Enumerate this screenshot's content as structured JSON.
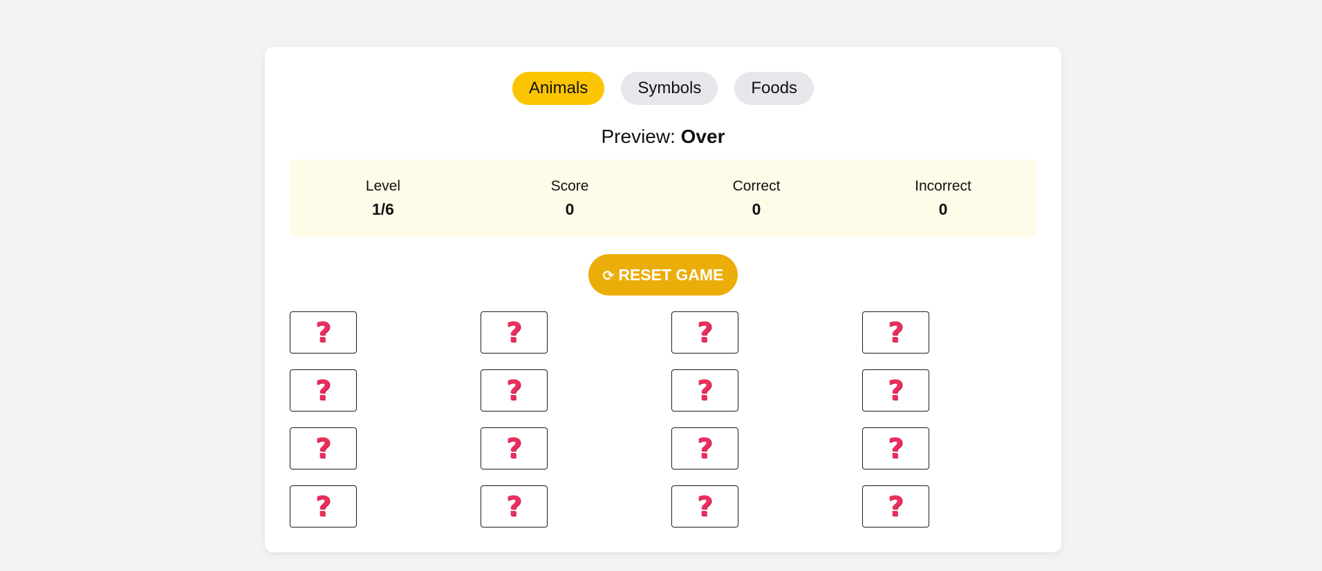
{
  "tabs": [
    {
      "label": "Animals",
      "active": true
    },
    {
      "label": "Symbols",
      "active": false
    },
    {
      "label": "Foods",
      "active": false
    }
  ],
  "preview": {
    "label": "Preview:",
    "value": "Over"
  },
  "stats": [
    {
      "label": "Level",
      "value": "1/6"
    },
    {
      "label": "Score",
      "value": "0"
    },
    {
      "label": "Correct",
      "value": "0"
    },
    {
      "label": "Incorrect",
      "value": "0"
    }
  ],
  "reset_button": {
    "icon": "refresh-icon",
    "glyph": "⟳",
    "label": "RESET GAME"
  },
  "tiles": {
    "hidden_glyph": "?",
    "hidden_icon": "question-mark-icon",
    "count": 16
  },
  "colors": {
    "accent_active_tab": "#fbc503",
    "reset_button": "#ebad09",
    "stats_background": "#fefbe8",
    "question_mark": "#ea2f5c"
  }
}
